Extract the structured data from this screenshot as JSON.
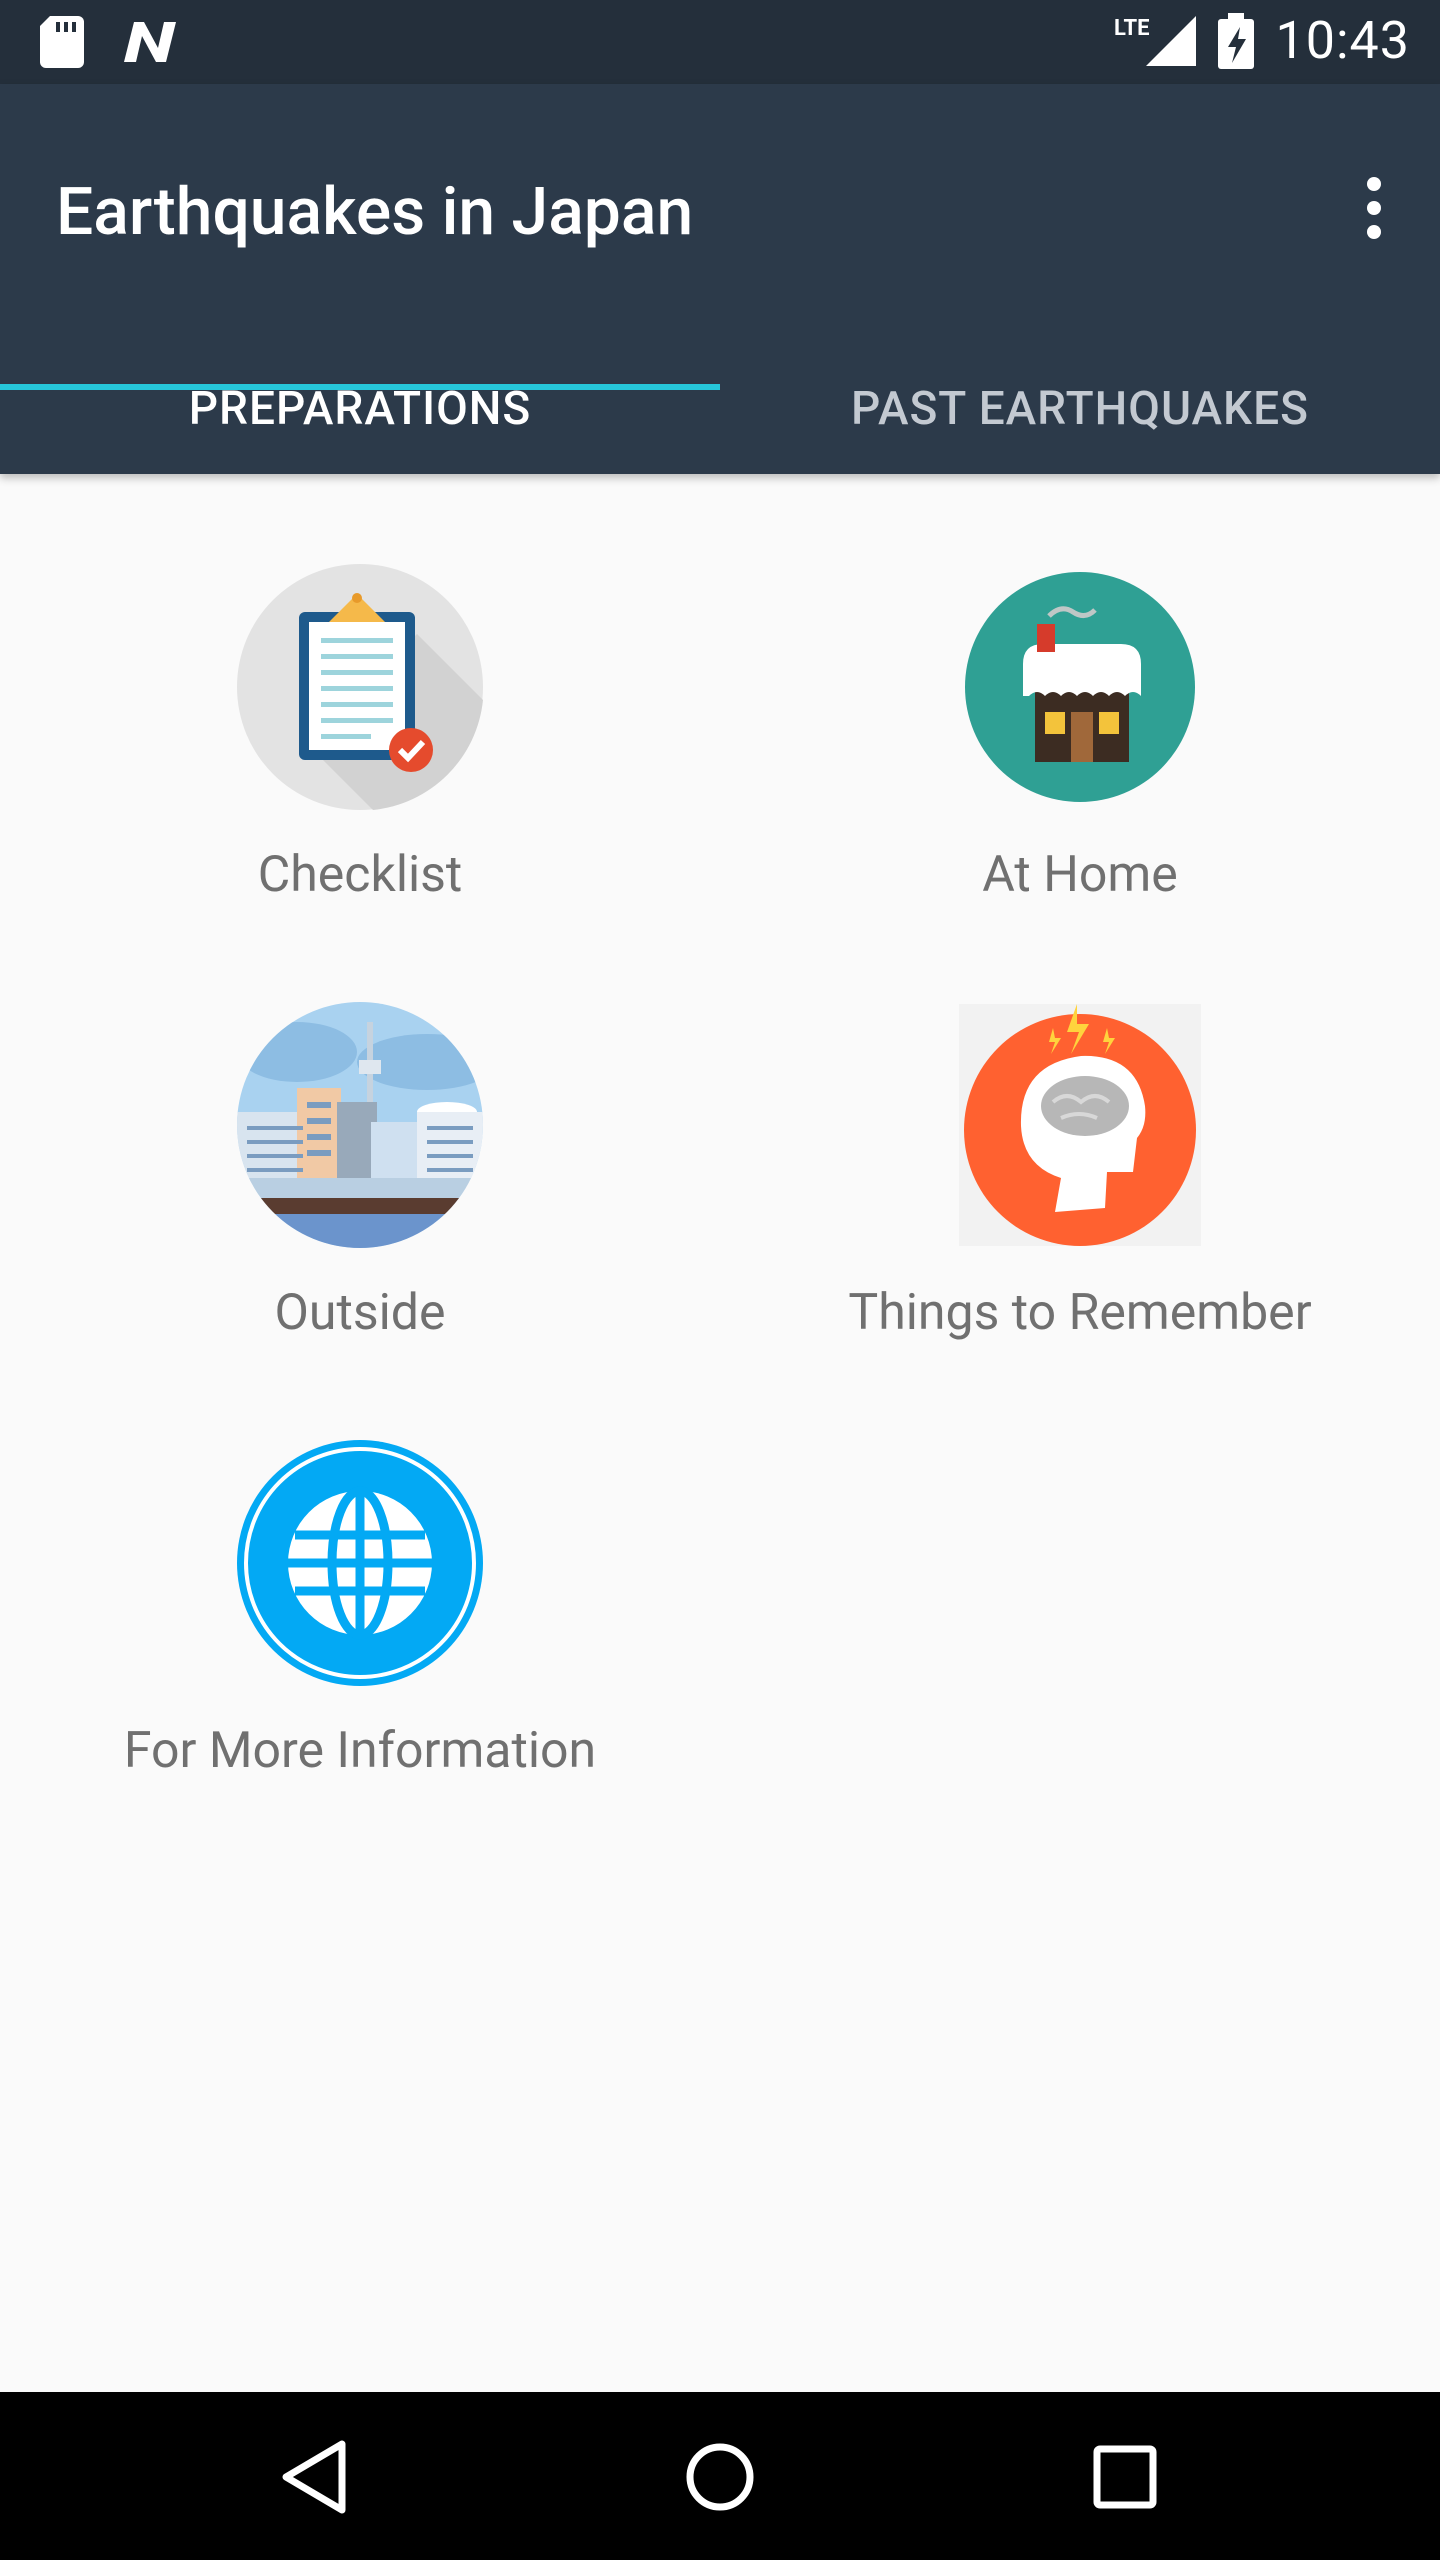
{
  "status_bar": {
    "time": "10:43",
    "network_label": "LTE",
    "icons": [
      "sd-card-icon",
      "n-notification-icon",
      "signal-icon",
      "battery-icon"
    ]
  },
  "app_bar": {
    "title": "Earthquakes in Japan",
    "overflow_icon": "more-vert-icon",
    "background": "#2c3a4a"
  },
  "tabs": [
    {
      "label": "PREPARATIONS",
      "selected": true
    },
    {
      "label": "PAST EARTHQUAKES",
      "selected": false
    }
  ],
  "accent_color": "#26c6da",
  "items": [
    {
      "label": "Checklist",
      "icon": "clipboard-checklist-icon"
    },
    {
      "label": "At Home",
      "icon": "house-icon"
    },
    {
      "label": "Outside",
      "icon": "city-skyline-icon"
    },
    {
      "label": "Things to Remember",
      "icon": "head-brain-icon"
    },
    {
      "label": "For More Information",
      "icon": "globe-icon"
    }
  ],
  "nav_bar": {
    "buttons": [
      "back-icon",
      "home-icon",
      "recents-icon"
    ]
  }
}
